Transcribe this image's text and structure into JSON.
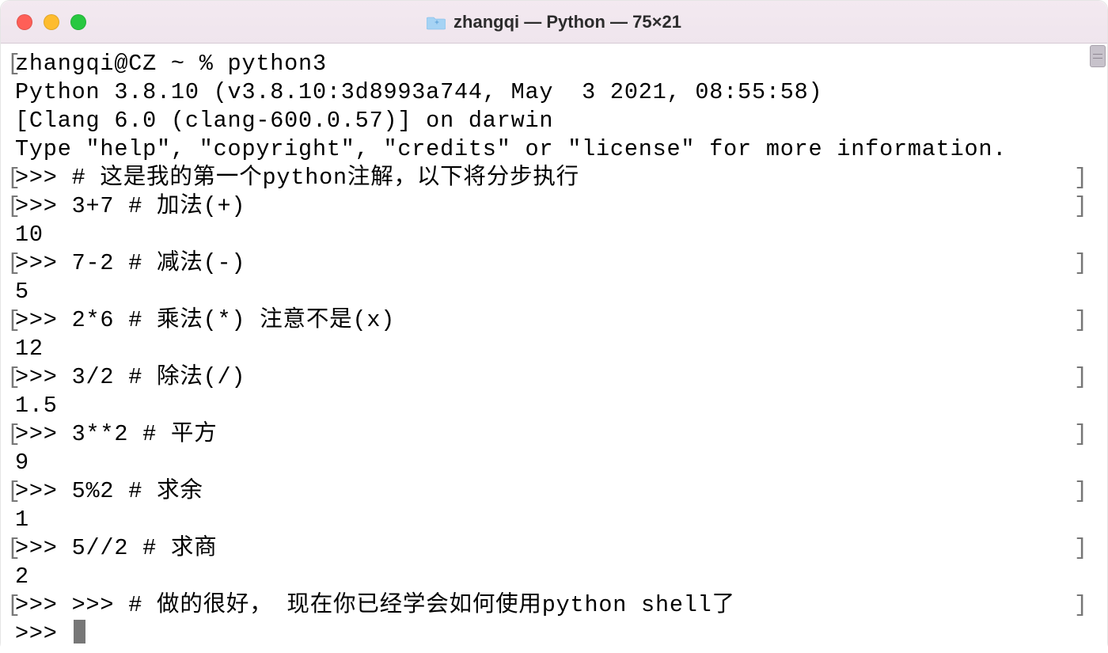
{
  "window": {
    "title": "zhangqi — Python — 75×21"
  },
  "terminal": {
    "lines": [
      {
        "left": "[",
        "text": "zhangqi@CZ ~ % python3",
        "right": " "
      },
      {
        "left": " ",
        "text": "Python 3.8.10 (v3.8.10:3d8993a744, May  3 2021, 08:55:58)",
        "right": " "
      },
      {
        "left": " ",
        "text": "[Clang 6.0 (clang-600.0.57)] on darwin",
        "right": " "
      },
      {
        "left": " ",
        "text": "Type \"help\", \"copyright\", \"credits\" or \"license\" for more information.",
        "right": " "
      },
      {
        "left": "[",
        "text": ">>> # 这是我的第一个python注解，以下将分步执行",
        "right": "]"
      },
      {
        "left": "[",
        "text": ">>> 3+7 # 加法(+)",
        "right": "]"
      },
      {
        "left": " ",
        "text": "10",
        "right": " "
      },
      {
        "left": "[",
        "text": ">>> 7-2 # 减法(-)",
        "right": "]"
      },
      {
        "left": " ",
        "text": "5",
        "right": " "
      },
      {
        "left": "[",
        "text": ">>> 2*6 # 乘法(*) 注意不是(x)",
        "right": "]"
      },
      {
        "left": " ",
        "text": "12",
        "right": " "
      },
      {
        "left": "[",
        "text": ">>> 3/2 # 除法(/)",
        "right": "]"
      },
      {
        "left": " ",
        "text": "1.5",
        "right": " "
      },
      {
        "left": "[",
        "text": ">>> 3**2 # 平方",
        "right": "]"
      },
      {
        "left": " ",
        "text": "9",
        "right": " "
      },
      {
        "left": "[",
        "text": ">>> 5%2 # 求余",
        "right": "]"
      },
      {
        "left": " ",
        "text": "1",
        "right": " "
      },
      {
        "left": "[",
        "text": ">>> 5//2 # 求商",
        "right": "]"
      },
      {
        "left": " ",
        "text": "2",
        "right": " "
      },
      {
        "left": "[",
        "text": ">>> >>> # 做的很好， 现在你已经学会如何使用python shell了",
        "right": "]"
      },
      {
        "left": " ",
        "text": ">>> ",
        "right": " ",
        "cursor": true
      }
    ]
  }
}
